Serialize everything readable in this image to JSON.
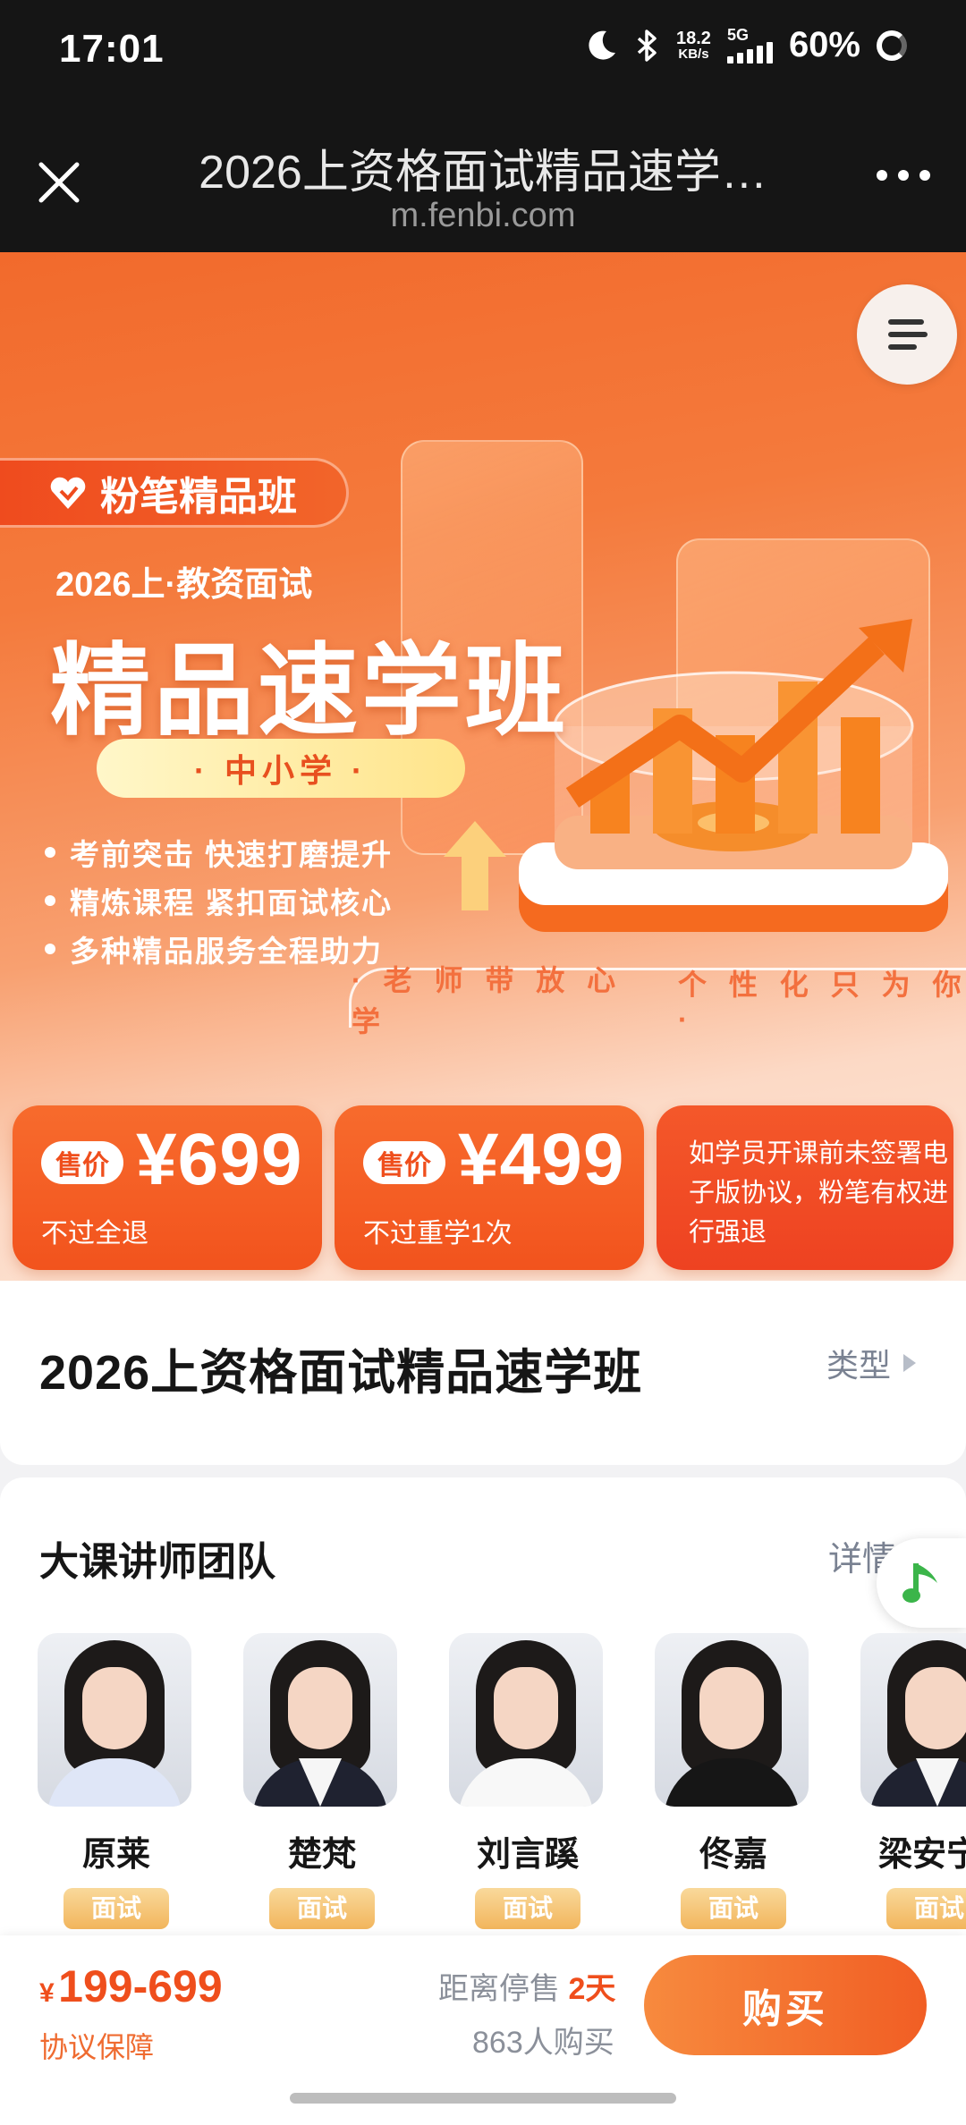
{
  "status_bar": {
    "time": "17:01",
    "net_speed_value": "18.2",
    "net_speed_unit": "KB/s",
    "network": "5G",
    "battery": "60%"
  },
  "nav": {
    "title": "2026上资格面试精品速学…",
    "url": "m.fenbi.com"
  },
  "hero": {
    "brand": "粉笔精品班",
    "subtitle": "2026上·教资面试",
    "title": "精品速学班",
    "level": "· 中小学 ·",
    "bullets": [
      "考前突击 快速打磨提升",
      "精炼课程 紧扣面试核心",
      "多种精品服务全程助力"
    ],
    "slogan_left": "· 老 师 带 放 心 学",
    "slogan_right": "个 性 化 只 为 你 ·",
    "prices": [
      {
        "tag": "售价",
        "amount": "¥699",
        "note": "不过全退"
      },
      {
        "tag": "售价",
        "amount": "¥499",
        "note": "不过重学1次"
      }
    ],
    "notice": "如学员开课前未签署电子版协议，粉笔有权进行强退"
  },
  "course": {
    "name": "2026上资格面试精品速学班",
    "type_label": "类型"
  },
  "teachers_section": {
    "title": "大课讲师团队",
    "more_label": "详情",
    "teachers": [
      {
        "name": "原莱",
        "role": "面试"
      },
      {
        "name": "楚梵",
        "role": "面试"
      },
      {
        "name": "刘言蹊",
        "role": "面试"
      },
      {
        "name": "佟嘉",
        "role": "面试"
      },
      {
        "name": "梁安宁",
        "role": "面试"
      }
    ]
  },
  "bottom_bar": {
    "currency": "¥",
    "price_range": "199-699",
    "guarantee": "协议保障",
    "countdown_label": "距离停售",
    "countdown_value": "2天",
    "buyers": "863人购买",
    "buy_label": "购买"
  },
  "colors": {
    "accent": "#f15e24",
    "banner_top": "#f26a2c",
    "status_bar_bg": "#151515"
  }
}
